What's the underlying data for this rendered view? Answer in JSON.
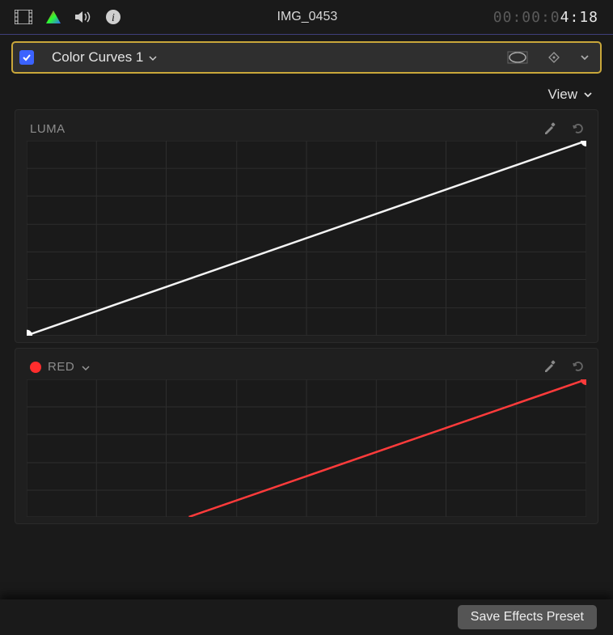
{
  "header": {
    "clip_name": "IMG_0453",
    "timecode_dim": "00:00:0",
    "timecode_bright": "4:18"
  },
  "effect_bar": {
    "enabled": true,
    "name": "Color Curves 1"
  },
  "view_menu": {
    "label": "View"
  },
  "curves": {
    "luma": {
      "label": "LUMA",
      "line_color": "#f4f4f4",
      "point_color": "#ffffff"
    },
    "red": {
      "label": "RED",
      "swatch_color": "#ff2d2d",
      "line_color": "#ff3b3b",
      "point_color": "#ff3b3b"
    }
  },
  "footer": {
    "save_preset_label": "Save Effects Preset"
  }
}
